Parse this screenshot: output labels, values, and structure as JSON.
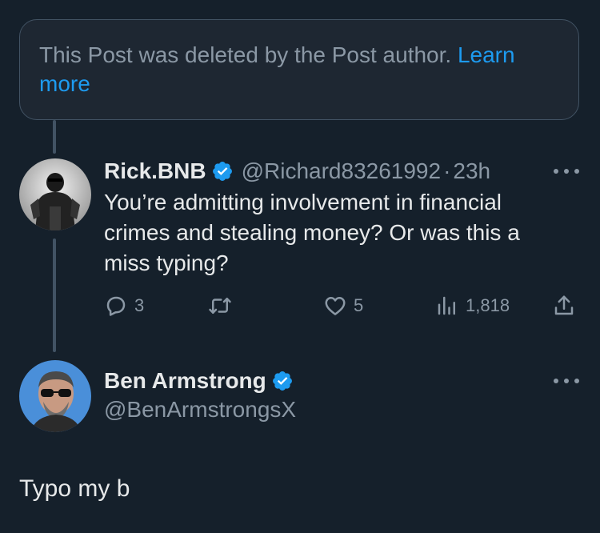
{
  "deleted_notice": {
    "text": "This Post was deleted by the Post author.",
    "learn_more": "Learn more"
  },
  "reply": {
    "display_name": "Rick.BNB",
    "handle": "@Richard83261992",
    "separator": "·",
    "time": "23h",
    "text": "You’re admitting involvement in financial crimes and stealing money? Or was this a miss typing?",
    "replies": "3",
    "likes": "5",
    "views": "1,818"
  },
  "main_post": {
    "display_name": "Ben Armstrong",
    "handle": "@BenArmstrongsX",
    "text": "Typo my b"
  },
  "colors": {
    "background": "#15202b",
    "accent": "#1d9bf0",
    "muted": "#8b98a5",
    "text": "#e7e9ea"
  },
  "icons": {
    "verified": "verified-badge-icon",
    "more": "more-dots-icon",
    "reply": "reply-icon",
    "repost": "repost-icon",
    "like": "heart-icon",
    "views": "views-bar-chart-icon",
    "share": "share-icon"
  }
}
